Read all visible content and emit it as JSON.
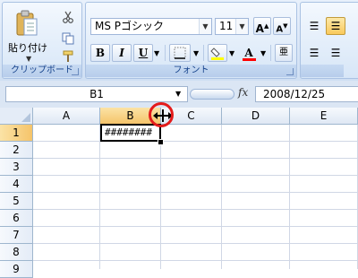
{
  "ribbon": {
    "clipboard": {
      "paste_label": "貼り付け",
      "group_title": "クリップボード"
    },
    "font": {
      "font_name": "MS Pゴシック",
      "font_size": "11",
      "bold": "B",
      "italic": "I",
      "underline": "U",
      "grow_font": "A",
      "shrink_font": "A",
      "font_color": "A",
      "group_title": "フォント"
    },
    "colors": {
      "fill_color": "#ffff00",
      "font_color": "#ff0000",
      "accent": "#15428b"
    }
  },
  "formula_bar": {
    "name_box": "B1",
    "fx_label": "fx",
    "formula": "2008/12/25"
  },
  "sheet": {
    "columns": [
      "A",
      "B",
      "C",
      "D",
      "E"
    ],
    "rows": [
      "1",
      "2",
      "3",
      "4",
      "5",
      "6",
      "7",
      "8",
      "9"
    ],
    "active_cell_display": "########",
    "selected_column": "B",
    "selected_row": "1",
    "cursor_icon": "column-resize-icon",
    "annotation_color": "#e41b1b"
  }
}
